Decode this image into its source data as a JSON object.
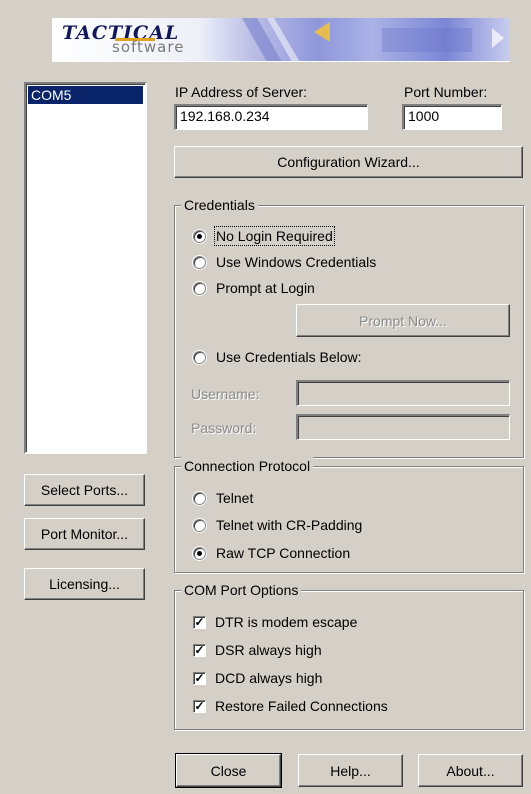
{
  "banner": {
    "logo_word1": "TACTICAL",
    "logo_word2": "software"
  },
  "port_list": {
    "items": [
      "COM5"
    ],
    "selected": "COM5"
  },
  "left_buttons": {
    "select_ports": "Select Ports...",
    "port_monitor": "Port Monitor...",
    "licensing": "Licensing..."
  },
  "server": {
    "ip_label": "IP Address of Server:",
    "ip_value": "192.168.0.234",
    "port_label": "Port Number:",
    "port_value": "1000"
  },
  "config_wizard_label": "Configuration Wizard...",
  "credentials": {
    "title": "Credentials",
    "options": [
      {
        "label": "No Login Required",
        "selected": true
      },
      {
        "label": "Use Windows Credentials",
        "selected": false
      },
      {
        "label": "Prompt at Login",
        "selected": false
      },
      {
        "label": "Use Credentials Below:",
        "selected": false
      }
    ],
    "prompt_now_label": "Prompt Now...",
    "username_label": "Username:",
    "username_value": "",
    "password_label": "Password:",
    "password_value": ""
  },
  "protocol": {
    "title": "Connection Protocol",
    "options": [
      {
        "label": "Telnet",
        "selected": false
      },
      {
        "label": "Telnet with CR-Padding",
        "selected": false
      },
      {
        "label": "Raw TCP Connection",
        "selected": true
      }
    ]
  },
  "com_options": {
    "title": "COM Port Options",
    "options": [
      {
        "label": "DTR is modem escape",
        "checked": true
      },
      {
        "label": "DSR always high",
        "checked": true
      },
      {
        "label": "DCD always high",
        "checked": true
      },
      {
        "label": "Restore Failed Connections",
        "checked": true
      }
    ]
  },
  "footer": {
    "close": "Close",
    "help": "Help...",
    "about": "About..."
  }
}
